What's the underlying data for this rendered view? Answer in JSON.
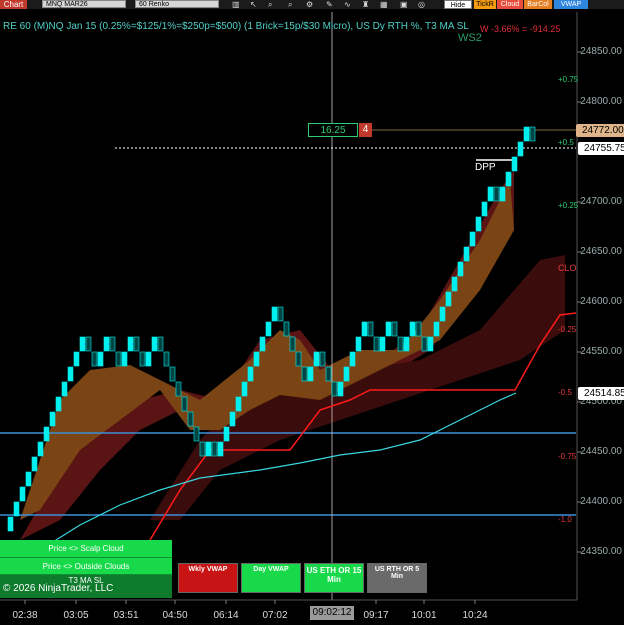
{
  "toolbar": {
    "chart_tab": "Chart",
    "instrument": "MNQ MAR26",
    "bar_type": "60 Renko",
    "hide_label": "Hide",
    "tick_label": "TickR",
    "cloud_label": "Cloud",
    "barcol_label": "BarCol",
    "vwap_label": "VWAP"
  },
  "chart": {
    "header": "RE 60 (M)NQ Jan 15 (0.25%=$125/1%=$250p=$500) (1 Brick=15p/$30 Micro), US Dy RTH %, T3 MA SL",
    "pnl_text": "W -3.66% = -914.25",
    "ws2": "WS2",
    "dpp": "DPP",
    "clo": "CLO",
    "position_qty": "16.25",
    "position_count": "4",
    "current_price": "24772.00",
    "crosshair_price": "24755.75",
    "vwap_price": "24514.85",
    "cursor_time": "09:02:12",
    "copyright": "© 2026 NinjaTrader, LLC"
  },
  "axes": {
    "price_labels": [
      "24850.00",
      "24800.00",
      "24700.00",
      "24650.00",
      "24600.00",
      "24550.00",
      "24500.00",
      "24450.00",
      "24400.00",
      "24350.00"
    ],
    "pct_labels": [
      "+0.75",
      "+0.5",
      "+0.25",
      "-0.25",
      "-0.5",
      "-0.75",
      "-1.0"
    ],
    "time_labels": [
      "02:38",
      "03:05",
      "03:51",
      "04:50",
      "06:14",
      "07:02",
      "09:17",
      "10:01",
      "10:24"
    ]
  },
  "panels": {
    "scalp_cloud": "Price <> Scalp Cloud",
    "outside_clouds": "Price <> Outside Clouds",
    "t3_ma": "T3 MA SL",
    "wkly_vwap": "Wkly VWAP",
    "day_vwap": "Day VWAP",
    "us_eth_or": "US ETH OR 15 Min",
    "us_rth_or": "US RTH OR 5 Min"
  },
  "colors": {
    "up_brick": "#00f0f0",
    "down_brick": "#004444",
    "cloud_orange": "#b5651d",
    "cloud_red": "#5a1010",
    "t3_line": "#ff1a1a",
    "vwap_line": "#39d6e0",
    "level_line": "#3a8fd8",
    "green_btn": "#17d94a",
    "red_btn": "#c81414",
    "gray_btn": "#6a6a6a"
  },
  "chart_data": {
    "type": "renko",
    "brick_size": 15,
    "ylim": [
      24330,
      24895
    ],
    "bricks": [
      [
        24385,
        "u"
      ],
      [
        24400,
        "u"
      ],
      [
        24415,
        "u"
      ],
      [
        24430,
        "u"
      ],
      [
        24445,
        "u"
      ],
      [
        24460,
        "u"
      ],
      [
        24475,
        "u"
      ],
      [
        24490,
        "u"
      ],
      [
        24505,
        "u"
      ],
      [
        24520,
        "u"
      ],
      [
        24535,
        "u"
      ],
      [
        24550,
        "u"
      ],
      [
        24565,
        "u"
      ],
      [
        24550,
        "d"
      ],
      [
        24535,
        "d"
      ],
      [
        24550,
        "u"
      ],
      [
        24565,
        "u"
      ],
      [
        24550,
        "d"
      ],
      [
        24535,
        "d"
      ],
      [
        24550,
        "u"
      ],
      [
        24565,
        "u"
      ],
      [
        24550,
        "d"
      ],
      [
        24535,
        "d"
      ],
      [
        24550,
        "u"
      ],
      [
        24565,
        "u"
      ],
      [
        24550,
        "d"
      ],
      [
        24535,
        "d"
      ],
      [
        24520,
        "d"
      ],
      [
        24505,
        "d"
      ],
      [
        24490,
        "d"
      ],
      [
        24475,
        "d"
      ],
      [
        24460,
        "d"
      ],
      [
        24445,
        "d"
      ],
      [
        24460,
        "u"
      ],
      [
        24445,
        "d"
      ],
      [
        24460,
        "u"
      ],
      [
        24475,
        "u"
      ],
      [
        24490,
        "u"
      ],
      [
        24505,
        "u"
      ],
      [
        24520,
        "u"
      ],
      [
        24535,
        "u"
      ],
      [
        24550,
        "u"
      ],
      [
        24565,
        "u"
      ],
      [
        24580,
        "u"
      ],
      [
        24595,
        "u"
      ],
      [
        24580,
        "d"
      ],
      [
        24565,
        "d"
      ],
      [
        24550,
        "d"
      ],
      [
        24535,
        "d"
      ],
      [
        24520,
        "d"
      ],
      [
        24535,
        "u"
      ],
      [
        24550,
        "u"
      ],
      [
        24535,
        "d"
      ],
      [
        24520,
        "d"
      ],
      [
        24505,
        "d"
      ],
      [
        24520,
        "u"
      ],
      [
        24535,
        "u"
      ],
      [
        24550,
        "u"
      ],
      [
        24565,
        "u"
      ],
      [
        24580,
        "u"
      ],
      [
        24565,
        "d"
      ],
      [
        24550,
        "d"
      ],
      [
        24565,
        "u"
      ],
      [
        24580,
        "u"
      ],
      [
        24565,
        "d"
      ],
      [
        24550,
        "d"
      ],
      [
        24565,
        "u"
      ],
      [
        24580,
        "u"
      ],
      [
        24565,
        "d"
      ],
      [
        24550,
        "d"
      ],
      [
        24565,
        "u"
      ],
      [
        24580,
        "u"
      ],
      [
        24595,
        "u"
      ],
      [
        24610,
        "u"
      ],
      [
        24625,
        "u"
      ],
      [
        24640,
        "u"
      ],
      [
        24655,
        "u"
      ],
      [
        24670,
        "u"
      ],
      [
        24685,
        "u"
      ],
      [
        24700,
        "u"
      ],
      [
        24715,
        "u"
      ],
      [
        24700,
        "d"
      ],
      [
        24715,
        "u"
      ],
      [
        24730,
        "u"
      ],
      [
        24745,
        "u"
      ],
      [
        24760,
        "u"
      ],
      [
        24775,
        "u"
      ],
      [
        24760,
        "d"
      ]
    ]
  }
}
